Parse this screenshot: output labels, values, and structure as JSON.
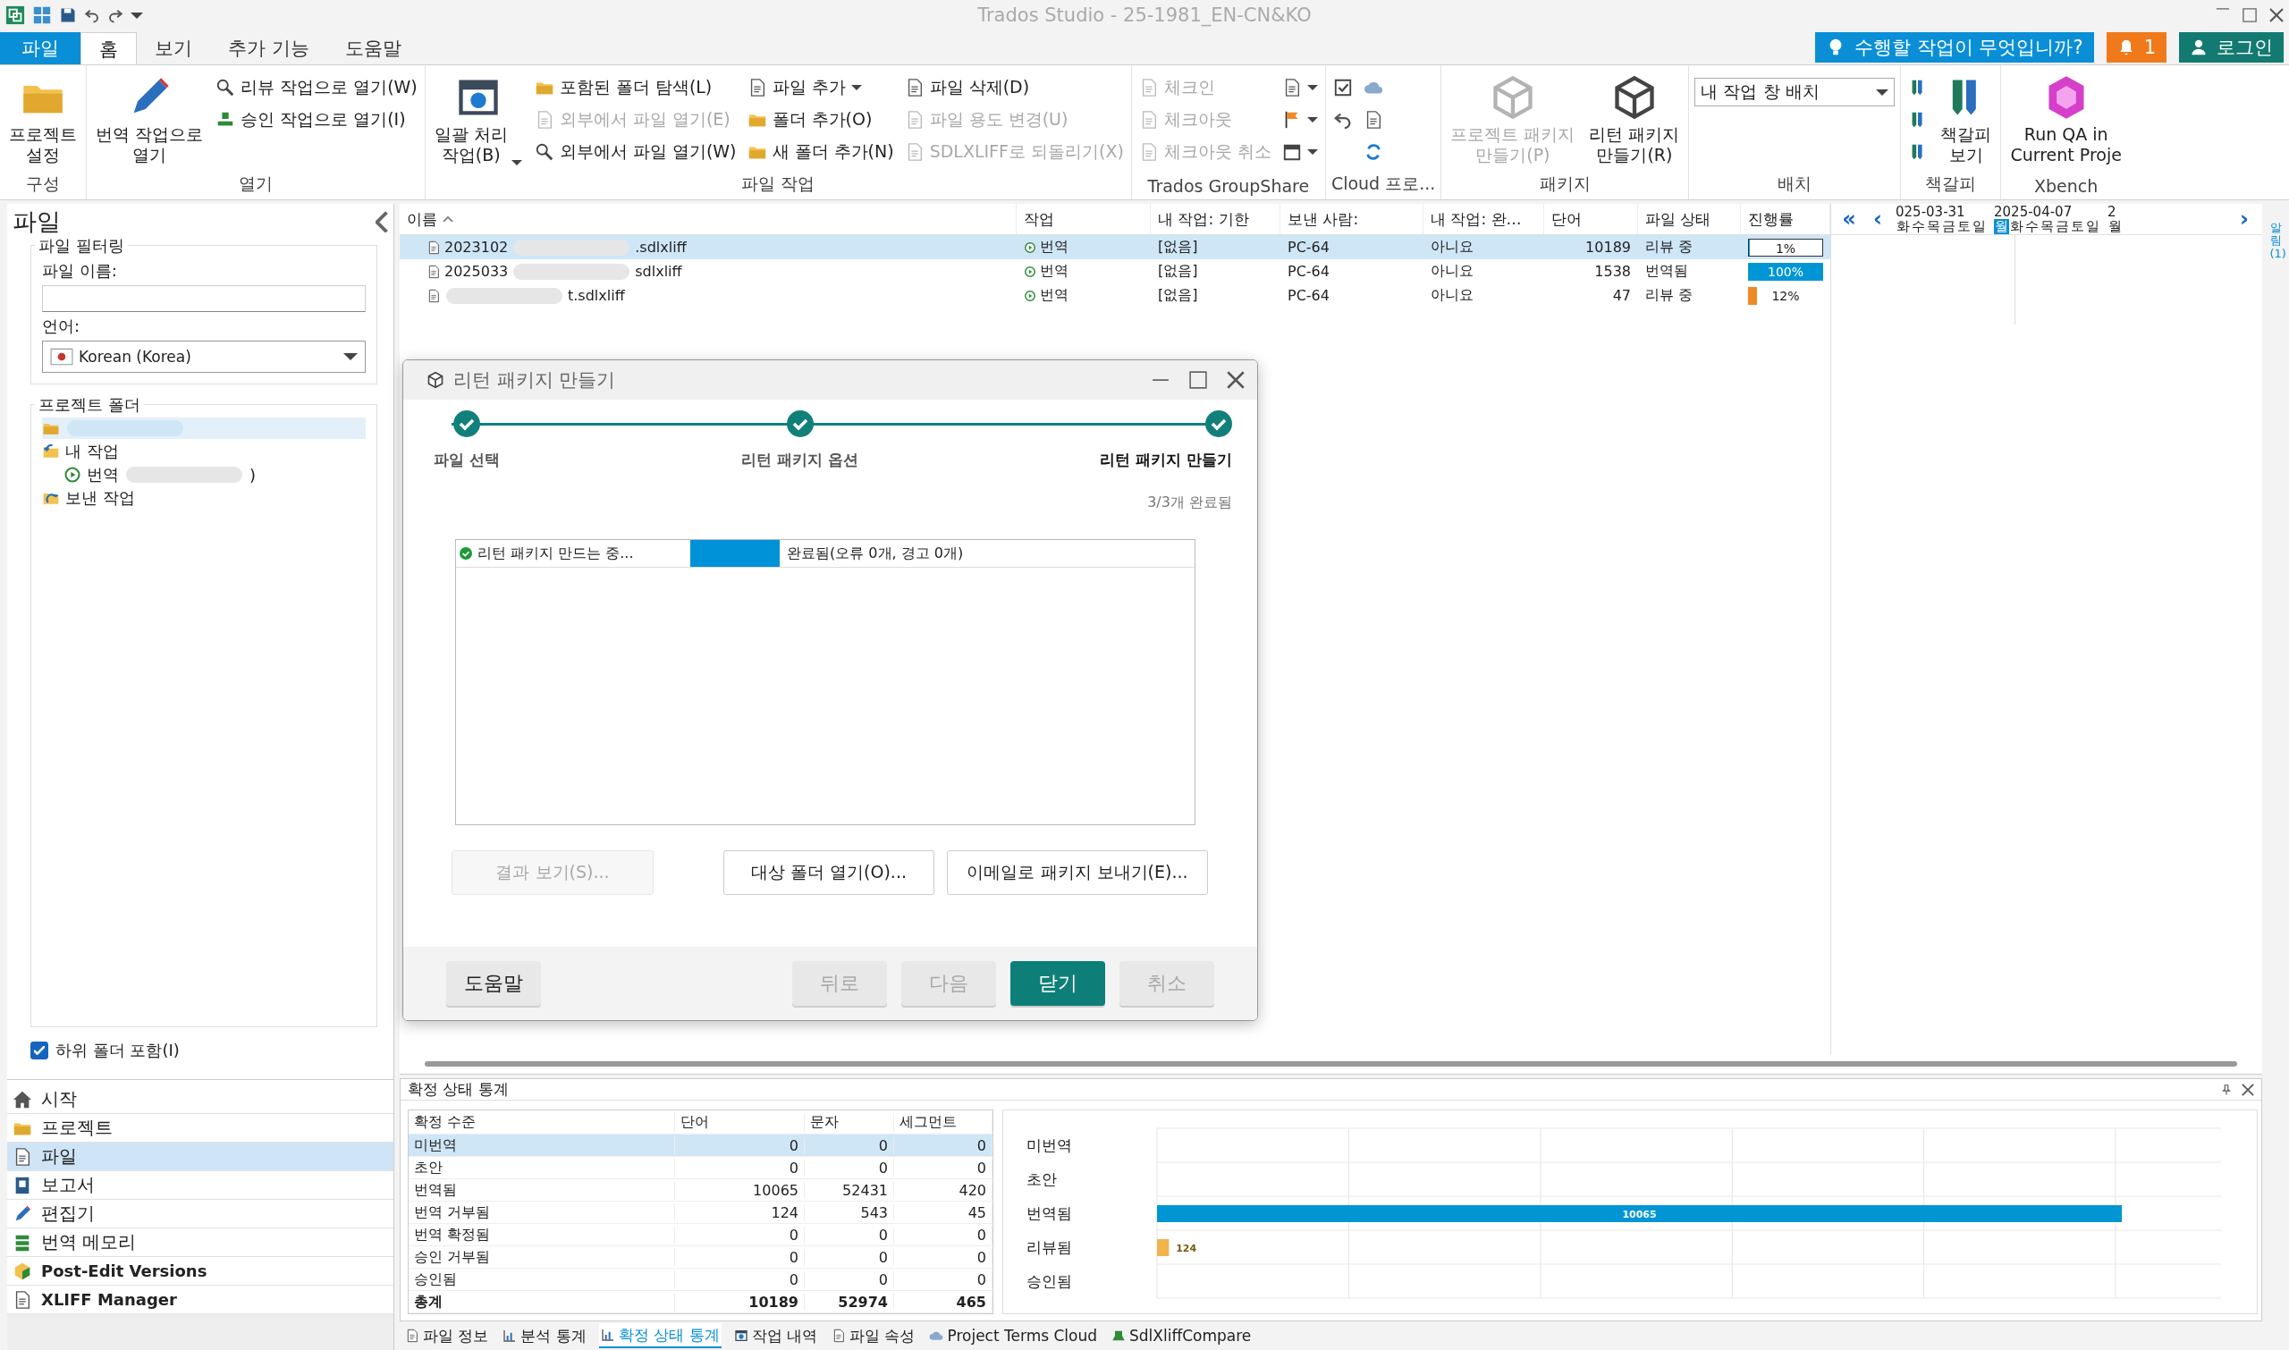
{
  "window": {
    "title": "Trados Studio - 25-1981_EN-CN&KO"
  },
  "top_buttons": {
    "tell_me": "수행할 작업이 무엇입니까?",
    "notifications": "1",
    "login": "로그인"
  },
  "ribbon_tabs": [
    {
      "label": "파일",
      "kind": "file",
      "selected": false
    },
    {
      "label": "홈",
      "kind": "tab",
      "selected": true
    },
    {
      "label": "보기",
      "kind": "tab",
      "selected": false
    },
    {
      "label": "추가 기능",
      "kind": "tab",
      "selected": false
    },
    {
      "label": "도움말",
      "kind": "tab",
      "selected": false
    }
  ],
  "ribbon_groups": [
    {
      "label": "구성",
      "columns": [
        [
          {
            "kind": "large",
            "label": "프로젝트\n설정",
            "disabled": false
          }
        ]
      ]
    },
    {
      "label": "열기",
      "columns": [
        [
          {
            "kind": "large",
            "label": "번역 작업으로\n열기",
            "disabled": false
          }
        ],
        [
          {
            "kind": "small",
            "label": "리뷰 작업으로 열기(W)",
            "disabled": false
          },
          {
            "kind": "small",
            "label": "승인 작업으로 열기(I)",
            "disabled": false
          }
        ]
      ]
    },
    {
      "label": "파일 작업",
      "columns": [
        [
          {
            "kind": "large",
            "label": "일괄 처리\n작업(B)",
            "disabled": false,
            "caret": true
          }
        ],
        [
          {
            "kind": "small",
            "label": "포함된 폴더 탐색(L)",
            "disabled": false
          },
          {
            "kind": "small",
            "label": "외부에서 파일 열기(E)",
            "disabled": true
          },
          {
            "kind": "small",
            "label": "외부에서 파일 열기(W)",
            "disabled": false
          }
        ],
        [
          {
            "kind": "small",
            "label": "파일 추가",
            "disabled": false,
            "caret": true
          },
          {
            "kind": "small",
            "label": "폴더 추가(O)",
            "disabled": false
          },
          {
            "kind": "small",
            "label": "새 폴더 추가(N)",
            "disabled": false
          }
        ],
        [
          {
            "kind": "small",
            "label": "파일 삭제(D)",
            "disabled": false
          },
          {
            "kind": "small",
            "label": "파일 용도 변경(U)",
            "disabled": true
          },
          {
            "kind": "small",
            "label": "SDLXLIFF로 되돌리기(X)",
            "disabled": true
          }
        ]
      ]
    },
    {
      "label": "Trados GroupShare",
      "columns": [
        [
          {
            "kind": "small",
            "label": "체크인",
            "disabled": true
          },
          {
            "kind": "small",
            "label": "체크아웃",
            "disabled": true
          },
          {
            "kind": "small",
            "label": "체크아웃 취소",
            "disabled": true
          }
        ],
        [
          {
            "kind": "icon",
            "disabled": false,
            "caret": true
          },
          {
            "kind": "icon",
            "disabled": false,
            "caret": true
          },
          {
            "kind": "icon",
            "disabled": false,
            "caret": true
          }
        ]
      ]
    },
    {
      "label": "Cloud 프로...",
      "columns": [
        [
          {
            "kind": "icon",
            "disabled": false
          },
          {
            "kind": "icon",
            "disabled": false
          }
        ],
        [
          {
            "kind": "icon",
            "disabled": false
          },
          {
            "kind": "icon",
            "disabled": false
          },
          {
            "kind": "icon",
            "disabled": false
          }
        ]
      ]
    },
    {
      "label": "패키지",
      "columns": [
        [
          {
            "kind": "large",
            "label": "프로젝트 패키지\n만들기(P)",
            "disabled": true
          }
        ],
        [
          {
            "kind": "large",
            "label": "리턴 패키지\n만들기(R)",
            "disabled": false
          }
        ]
      ]
    },
    {
      "label": "배치",
      "columns": [
        [
          {
            "kind": "combo",
            "label": "내 작업 창 배치",
            "disabled": false
          }
        ]
      ]
    },
    {
      "label": "책갈피",
      "columns": [
        [
          {
            "kind": "icon",
            "disabled": false
          },
          {
            "kind": "icon",
            "disabled": false
          },
          {
            "kind": "icon",
            "disabled": false
          }
        ],
        [
          {
            "kind": "large",
            "label": "책갈피\n보기",
            "disabled": false
          }
        ]
      ]
    },
    {
      "label": "Xbench",
      "columns": [
        [
          {
            "kind": "large",
            "label": "Run QA in\nCurrent Proje",
            "disabled": false
          }
        ]
      ]
    }
  ],
  "files_panel": {
    "title": "파일",
    "filter_legend": "파일 필터링",
    "name_label": "파일 이름:",
    "language_label": "언어:",
    "language": "Korean (Korea)",
    "folders_legend": "프로젝트 폴더",
    "tree": [
      {
        "redacted": true,
        "selected": true,
        "kind": "project"
      },
      {
        "label": "내 작업",
        "kind": "inbox",
        "selected": false,
        "children": [
          {
            "label": "번역",
            "label_end": ")",
            "redacted": true,
            "kind": "task",
            "selected": false
          }
        ]
      },
      {
        "label": "보낸 작업",
        "kind": "outbox",
        "selected": false
      }
    ],
    "include_subfolders": {
      "label": "하위 폴더 포함(I)",
      "checked": true
    }
  },
  "nav": [
    {
      "label": "시작",
      "kind": "builtin",
      "selected": false
    },
    {
      "label": "프로젝트",
      "kind": "builtin",
      "selected": false
    },
    {
      "label": "파일",
      "kind": "builtin",
      "selected": true
    },
    {
      "label": "보고서",
      "kind": "builtin",
      "selected": false
    },
    {
      "label": "편집기",
      "kind": "builtin",
      "selected": false
    },
    {
      "label": "번역 메모리",
      "kind": "builtin",
      "selected": false
    },
    {
      "label": "Post-Edit Versions",
      "kind": "plugin",
      "selected": false
    },
    {
      "label": "XLIFF Manager",
      "kind": "plugin",
      "selected": false
    }
  ],
  "file_table": {
    "columns": [
      "이름",
      "작업",
      "내 작업: 기한",
      "보낸 사람:",
      "내 작업: 완…",
      "단어",
      "파일 상태",
      "진행률"
    ],
    "rows": [
      {
        "name_start": "2023102",
        "name_end": ".sdlxliff",
        "redacted": true,
        "task": "번역",
        "due": "[없음]",
        "from": "PC-64",
        "done": "아니요",
        "words": "10189",
        "status": "리뷰 중",
        "progress": "1%",
        "level": 0.01,
        "selected": true
      },
      {
        "name_start": "2025033",
        "name_end": "sdlxliff",
        "redacted": true,
        "task": "번역",
        "due": "[없음]",
        "from": "PC-64",
        "done": "아니요",
        "words": "1538",
        "status": "번역됨",
        "progress": "100%",
        "level": 1,
        "color": "#0096d6",
        "selected": false
      },
      {
        "name_end": "t.sdlxliff",
        "redacted": true,
        "task": "번역",
        "due": "[없음]",
        "from": "PC-64",
        "done": "아니요",
        "words": "47",
        "status": "리뷰 중",
        "progress": "12%",
        "level": 0.12,
        "color": "#f08a24",
        "selected": false
      }
    ]
  },
  "calendar": {
    "first": "«",
    "prev": "‹",
    "next": "›",
    "weeks": [
      {
        "label": "025-03-31",
        "days": [
          {
            "label": "화",
            "selected": false
          },
          {
            "label": "수",
            "selected": false
          },
          {
            "label": "목",
            "selected": false
          },
          {
            "label": "금",
            "selected": false
          },
          {
            "label": "토",
            "selected": false
          },
          {
            "label": "일",
            "selected": false
          }
        ]
      },
      {
        "label": "2025-04-07",
        "days": [
          {
            "label": "월",
            "selected": true
          },
          {
            "label": "화",
            "selected": false
          },
          {
            "label": "수",
            "selected": false
          },
          {
            "label": "목",
            "selected": false
          },
          {
            "label": "금",
            "selected": false
          },
          {
            "label": "토",
            "selected": false
          },
          {
            "label": "일",
            "selected": false
          }
        ]
      },
      {
        "label": "2",
        "days": [
          {
            "label": "월",
            "selected": false
          }
        ]
      }
    ]
  },
  "side_tabs": [
    {
      "label": "알림 (1)"
    }
  ],
  "dialog": {
    "title": "리턴 패키지 만들기",
    "steps": [
      {
        "label": "파일 선택",
        "done": true,
        "selected": false
      },
      {
        "label": "리턴 패키지 옵션",
        "done": true,
        "selected": false
      },
      {
        "label": "리턴 패키지 만들기",
        "done": true,
        "selected": true
      }
    ],
    "progress_text": "3/3개 완료됨",
    "tasks": [
      {
        "label": "리턴 패키지 만드는 중...",
        "done": true,
        "level": 1,
        "result": "완료됨(오류 0개, 경고 0개)"
      }
    ],
    "actions": [
      {
        "label": "결과 보기(S)...",
        "disabled": true
      },
      {
        "label": "대상 폴더 열기(O)...",
        "disabled": false
      },
      {
        "label": "이메일로 패키지 보내기(E)...",
        "disabled": false
      }
    ],
    "footer": [
      {
        "label": "도움말",
        "kind": "normal",
        "disabled": false
      },
      {
        "label": "뒤로",
        "kind": "normal",
        "disabled": true
      },
      {
        "label": "다음",
        "kind": "normal",
        "disabled": true
      },
      {
        "label": "닫기",
        "kind": "primary",
        "disabled": false
      },
      {
        "label": "취소",
        "kind": "normal",
        "disabled": true
      }
    ]
  },
  "stats_panel": {
    "title": "확정 상태 통계",
    "columns": [
      "확정 수준",
      "단어",
      "문자",
      "세그먼트"
    ],
    "rows": [
      {
        "cells": [
          "미번역",
          "0",
          "0",
          "0"
        ],
        "kind": "row",
        "selected": true
      },
      {
        "cells": [
          "초안",
          "0",
          "0",
          "0"
        ],
        "kind": "row",
        "selected": false
      },
      {
        "cells": [
          "번역됨",
          "10065",
          "52431",
          "420"
        ],
        "kind": "row",
        "selected": false
      },
      {
        "cells": [
          "번역 거부됨",
          "124",
          "543",
          "45"
        ],
        "kind": "row",
        "selected": false
      },
      {
        "cells": [
          "번역 확정됨",
          "0",
          "0",
          "0"
        ],
        "kind": "row",
        "selected": false
      },
      {
        "cells": [
          "승인 거부됨",
          "0",
          "0",
          "0"
        ],
        "kind": "row",
        "selected": false
      },
      {
        "cells": [
          "승인됨",
          "0",
          "0",
          "0"
        ],
        "kind": "row",
        "selected": false
      },
      {
        "cells": [
          "총계",
          "10189",
          "52974",
          "465"
        ],
        "kind": "total",
        "selected": false
      }
    ],
    "chart_data": {
      "type": "bar",
      "orientation": "horizontal",
      "categories": [
        "미번역",
        "초안",
        "번역됨",
        "리뷰됨",
        "승인됨"
      ],
      "xlim": [
        0,
        11100
      ],
      "values": [
        0,
        0,
        10065,
        124,
        0
      ],
      "colors": [
        null,
        null,
        "#0096d6",
        "#f0b44c",
        null
      ],
      "value_labels": [
        null,
        null,
        "10065",
        "124",
        null
      ]
    }
  },
  "bottom_tabs": [
    {
      "label": "파일 정보",
      "selected": false
    },
    {
      "label": "분석 통계",
      "selected": false
    },
    {
      "label": "확정 상태 통계",
      "selected": true
    },
    {
      "label": "작업 내역",
      "selected": false
    },
    {
      "label": "파일 속성",
      "selected": false
    },
    {
      "label": "Project Terms Cloud",
      "selected": false
    },
    {
      "label": "SdlXliffCompare",
      "selected": false
    }
  ]
}
